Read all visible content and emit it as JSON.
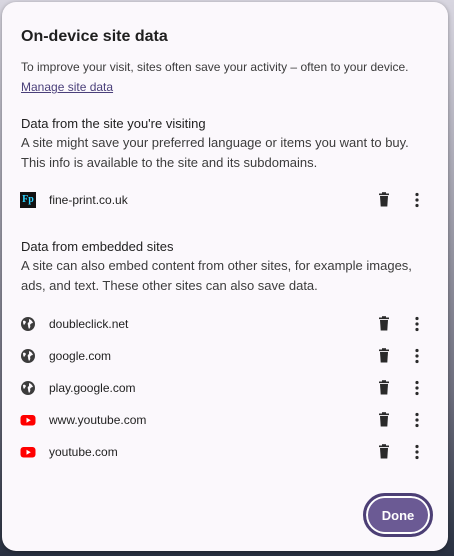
{
  "dialog": {
    "title": "On-device site data",
    "intro": "To improve your visit, sites often save your activity – often to your device.",
    "manage_link": "Manage site data"
  },
  "visited_section": {
    "heading": "Data from the site you're visiting",
    "description": "A site might save your preferred language or items you want to buy. This info is available to the site and its subdomains.",
    "sites": [
      {
        "name": "fine-print.co.uk",
        "icon": "fine-print-favicon"
      }
    ]
  },
  "embedded_section": {
    "heading": "Data from embedded sites",
    "description": "A site can also embed content from other sites, for example images, ads, and text. These other sites can also save data.",
    "sites": [
      {
        "name": "doubleclick.net",
        "icon": "globe-icon"
      },
      {
        "name": "google.com",
        "icon": "globe-icon"
      },
      {
        "name": "play.google.com",
        "icon": "globe-icon"
      },
      {
        "name": "www.youtube.com",
        "icon": "youtube-icon"
      },
      {
        "name": "youtube.com",
        "icon": "youtube-icon"
      }
    ]
  },
  "actions": {
    "done_label": "Done"
  },
  "colors": {
    "accent": "#6b5a94",
    "link": "#4a3f7a",
    "youtube_red": "#ff0000"
  }
}
